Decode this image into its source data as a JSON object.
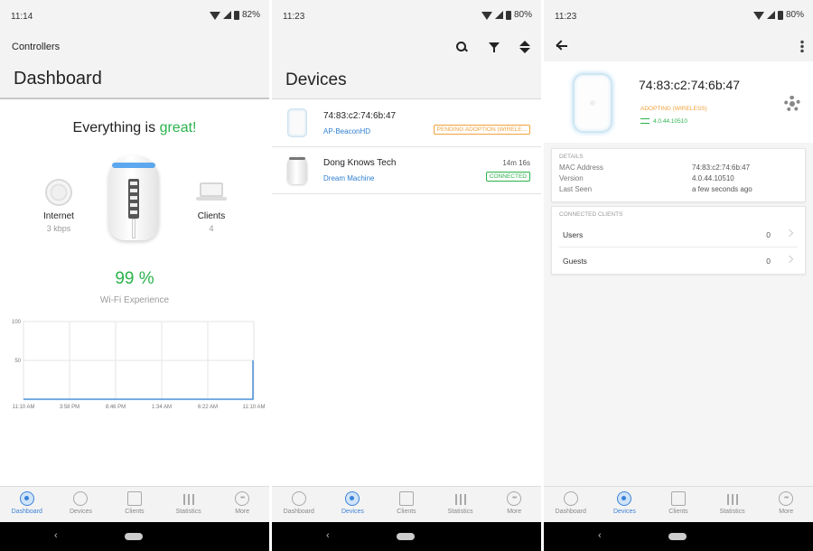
{
  "screen1": {
    "status": {
      "time": "11:14",
      "battery": "82%"
    },
    "controllers_label": "Controllers",
    "title": "Dashboard",
    "headline_prefix": "Everything is ",
    "headline_status": "great!",
    "internet": {
      "label": "Internet",
      "value": "3 kbps"
    },
    "clients": {
      "label": "Clients",
      "value": "4"
    },
    "wifi_experience": {
      "value": "99 %",
      "label": "Wi-Fi Experience"
    },
    "chart_data": {
      "type": "line",
      "x": [
        "11:10 AM",
        "3:58 PM",
        "8:46 PM",
        "1:34 AM",
        "6:22 AM",
        "11:10 AM"
      ],
      "yticks": [
        "100",
        "50"
      ],
      "ylim": [
        0,
        100
      ],
      "series": [
        {
          "values": [
            0,
            0,
            0,
            0,
            0,
            50
          ]
        }
      ],
      "grid": true,
      "color": "#4a90d9"
    },
    "nav_active": "Dashboard"
  },
  "screen2": {
    "status": {
      "time": "11:23",
      "battery": "80%"
    },
    "title": "Devices",
    "devices": [
      {
        "name": "74:83:c2:74:6b:47",
        "model": "AP-BeaconHD",
        "time": "",
        "badge": "PENDING ADOPTION (WIRELE..."
      },
      {
        "name": "Dong Knows Tech",
        "model": "Dream Machine",
        "time": "14m 16s",
        "badge": "CONNECTED"
      }
    ],
    "nav_active": "Devices"
  },
  "screen3": {
    "status": {
      "time": "11:23",
      "battery": "80%"
    },
    "mac": "74:83:c2:74:6b:47",
    "adopt_status": "ADOPTING (WIRELESS)",
    "version_short": "4.0.44.10510",
    "details_caption": "DETAILS",
    "details": [
      {
        "key": "MAC Address",
        "value": "74:83:c2:74:6b:47"
      },
      {
        "key": "Version",
        "value": "4.0.44.10510"
      },
      {
        "key": "Last Seen",
        "value": "a few seconds ago"
      }
    ],
    "clients_caption": "CONNECTED CLIENTS",
    "clients": [
      {
        "key": "Users",
        "value": "0"
      },
      {
        "key": "Guests",
        "value": "0"
      }
    ],
    "nav_active": "Devices"
  },
  "nav_labels": [
    "Dashboard",
    "Devices",
    "Clients",
    "Statistics",
    "More"
  ],
  "colors": {
    "accent": "#3b82d6",
    "success": "#2bb24c",
    "warning": "#f0a23b"
  }
}
